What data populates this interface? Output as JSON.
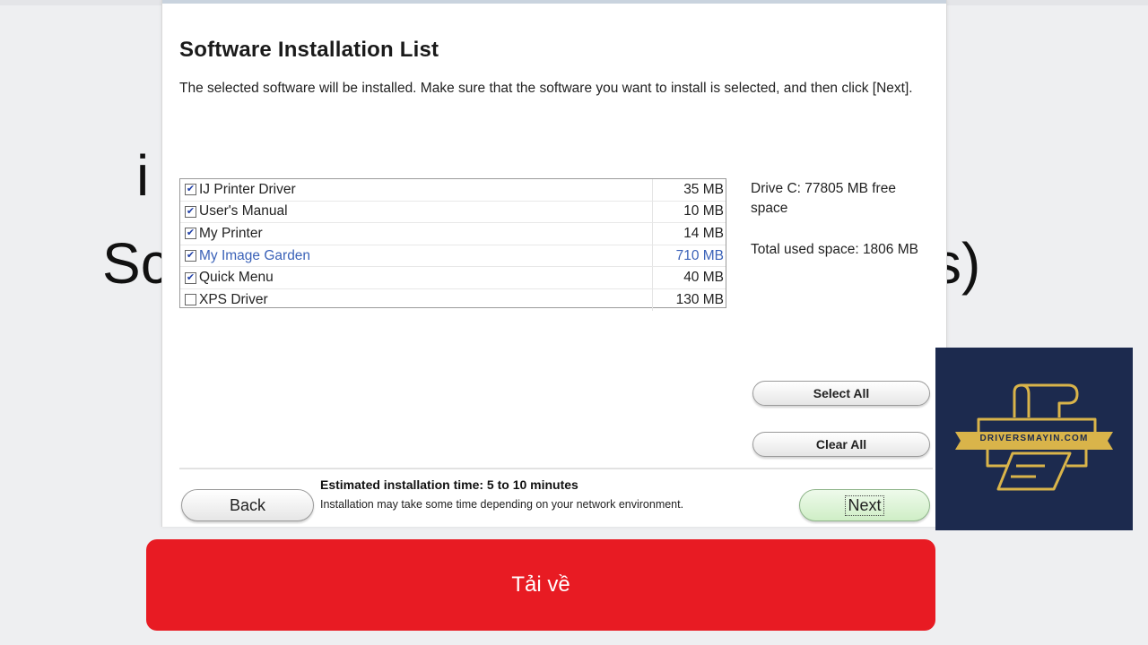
{
  "background": {
    "line1_fragment": "i",
    "line2_left_fragment": "Sc",
    "line2_right_fragment": "s)"
  },
  "dialog": {
    "title": "Software Installation List",
    "description": "The selected software will be installed. Make sure that the software you want to install is selected, and then click [Next].",
    "software": [
      {
        "name": "IJ Printer Driver",
        "size": "35 MB",
        "checked": true
      },
      {
        "name": "User's Manual",
        "size": "10 MB",
        "checked": true
      },
      {
        "name": "My Printer",
        "size": "14 MB",
        "checked": true
      },
      {
        "name": "My Image Garden",
        "size": "710 MB",
        "checked": true,
        "highlighted": true
      },
      {
        "name": "Quick Menu",
        "size": "40 MB",
        "checked": true
      },
      {
        "name": "XPS Driver",
        "size": "130 MB",
        "checked": false
      }
    ],
    "drive_info": "Drive C: 77805 MB free space",
    "total_used": "Total used space: 1806 MB",
    "select_all_label": "Select All",
    "clear_all_label": "Clear All",
    "back_label": "Back",
    "next_label": "Next",
    "estimated_time": "Estimated installation time: 5 to 10 minutes",
    "estimated_note": "Installation may take some time depending on your network environment."
  },
  "download_button": {
    "label": "Tải về"
  },
  "logo": {
    "text": "DRIVERSMAYIN.COM"
  },
  "colors": {
    "download_red": "#e81b23",
    "logo_navy": "#1c2a4e",
    "logo_gold": "#d9b44a",
    "next_green": "#cfeec6",
    "highlight_blue": "#3b62b8"
  }
}
